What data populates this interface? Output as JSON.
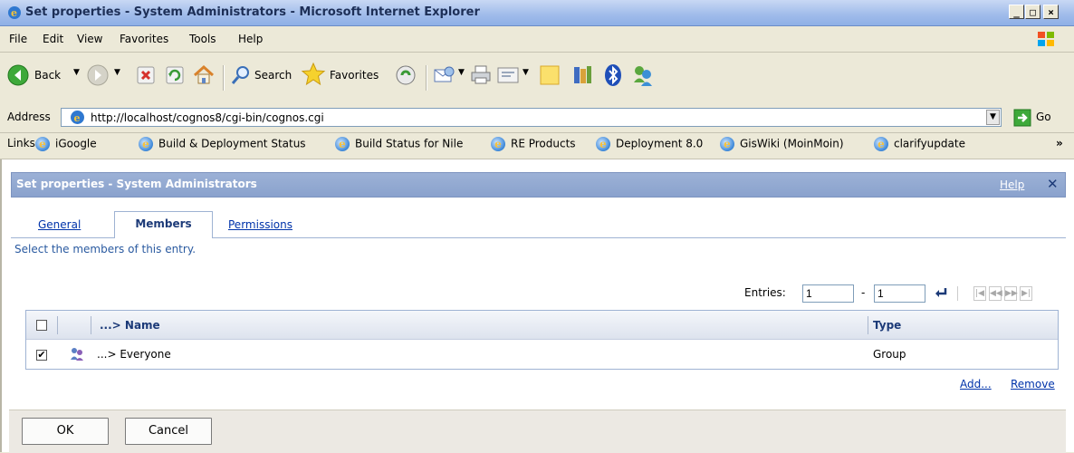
{
  "window": {
    "title": "Set properties - System Administrators - Microsoft Internet Explorer",
    "minimize": "_",
    "maximize": "□",
    "close": "×"
  },
  "menu": [
    "File",
    "Edit",
    "View",
    "Favorites",
    "Tools",
    "Help"
  ],
  "toolbar": {
    "back": "Back",
    "search": "Search",
    "favorites": "Favorites"
  },
  "address": {
    "label": "Address",
    "url": "http://localhost/cognos8/cgi-bin/cognos.cgi",
    "go": "Go"
  },
  "links": {
    "label": "Links",
    "items": [
      "iGoogle",
      "Build & Deployment Status",
      "Build Status for Nile",
      "RE Products",
      "Deployment 8.0",
      "GisWiki (MoinMoin)",
      "clarifyupdate"
    ],
    "more": "»"
  },
  "dialog": {
    "title": "Set properties - System Administrators",
    "help": "Help",
    "close": "✕",
    "tabs": [
      "General",
      "Members",
      "Permissions"
    ],
    "description": "Select the members of this entry.",
    "entries_label": "Entries:",
    "entries_from": "1",
    "entries_dash": "-",
    "entries_to": "1",
    "columns": {
      "name": "...> Name",
      "type": "Type"
    },
    "rows": [
      {
        "name": "...> Everyone",
        "type": "Group",
        "checked": true
      }
    ],
    "add": "Add...",
    "remove": "Remove",
    "ok": "OK",
    "cancel": "Cancel"
  }
}
